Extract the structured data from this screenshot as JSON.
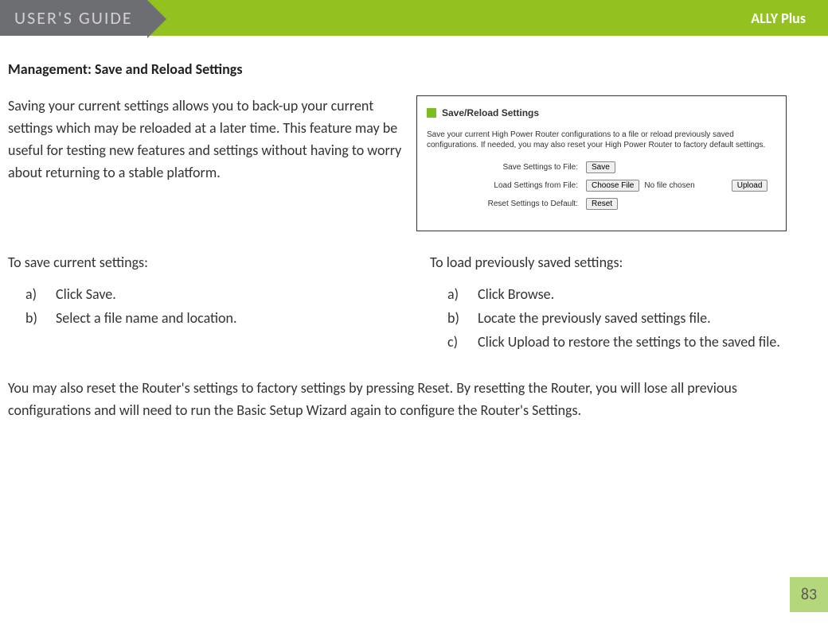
{
  "header": {
    "guide": "USER'S GUIDE",
    "product": "ALLY Plus"
  },
  "section_title": "Management: Save and Reload Settings",
  "intro_text": "Saving your current settings allows you to back-up your current settings which may be reloaded at a later time.  This feature may be useful for testing new features and settings without having to worry about returning to a stable platform.",
  "inset": {
    "title": "Save/Reload Settings",
    "description": "Save your current High Power Router configurations to a file or reload previously saved configurations. If needed, you may also reset your High Power Router to factory default settings.",
    "rows": {
      "save": {
        "label": "Save Settings to File:",
        "button": "Save"
      },
      "load": {
        "label": "Load Settings from File:",
        "choose": "Choose File",
        "status": "No file chosen",
        "upload": "Upload"
      },
      "reset": {
        "label": "Reset Settings to Default:",
        "button": "Reset"
      }
    }
  },
  "columns": {
    "save": {
      "title": "To save current settings:",
      "steps": [
        {
          "marker": "a)",
          "text": "Click Save."
        },
        {
          "marker": "b)",
          "text": "Select a file name and location."
        }
      ]
    },
    "load": {
      "title": "To load previously saved settings:",
      "steps": [
        {
          "marker": "a)",
          "text": "Click Browse."
        },
        {
          "marker": "b)",
          "text": "Locate the previously saved settings file."
        },
        {
          "marker": "c)",
          "text": "Click Upload to restore the settings to the saved file."
        }
      ]
    }
  },
  "bottom_text": "You may also reset the Router's settings to factory settings by pressing Reset.  By resetting the Router, you will lose all previous configurations and will need to run the Basic Setup Wizard again to configure the Router's Settings.",
  "page_number": "83"
}
